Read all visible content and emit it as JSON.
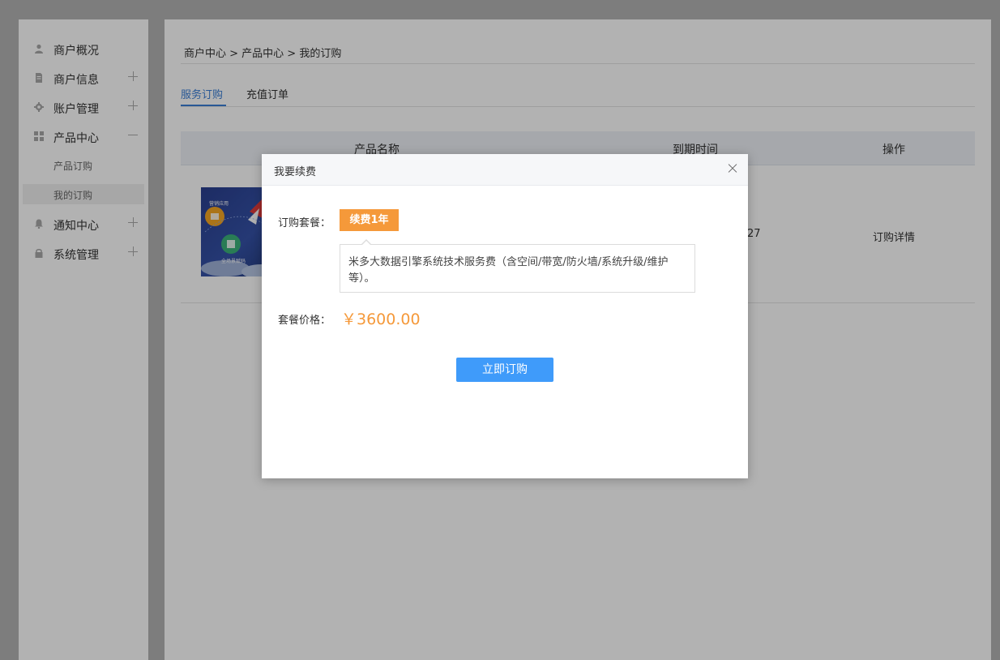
{
  "sidebar": {
    "items": [
      {
        "label": "商户概况",
        "icon": "user-icon"
      },
      {
        "label": "商户信息",
        "icon": "document-icon",
        "expand": "plus"
      },
      {
        "label": "账户管理",
        "icon": "gear-icon",
        "expand": "plus"
      },
      {
        "label": "产品中心",
        "icon": "grid-icon",
        "expand": "minus"
      },
      {
        "label": "通知中心",
        "icon": "bell-icon",
        "expand": "plus"
      },
      {
        "label": "系统管理",
        "icon": "lock-icon",
        "expand": "plus"
      }
    ],
    "sub_items": [
      {
        "label": "产品订购"
      },
      {
        "label": "我的订购",
        "active": true
      }
    ]
  },
  "main": {
    "breadcrumb": "商户中心 > 产品中心 > 我的订购",
    "tabs": [
      {
        "label": "服务订购",
        "active": true
      },
      {
        "label": "充值订单"
      }
    ],
    "table": {
      "headers": [
        "产品名称",
        "到期时间",
        "操作"
      ],
      "row": {
        "thumb_caption_top": "营销应用",
        "thumb_caption_bottom": "全场景赋码",
        "expiry_fragment": "27",
        "action": "订购详情"
      }
    }
  },
  "modal": {
    "title": "我要续费",
    "plan_label": "订购套餐：",
    "plan_tag": "续费1年",
    "plan_description": "米多大数据引擎系统技术服务费（含空间/带宽/防火墙/系统升级/维护等）。",
    "price_label": "套餐价格：",
    "price": "￥3600.00",
    "submit_label": "立即订购"
  },
  "colors": {
    "accent_blue": "#3f9bfa",
    "tab_blue": "#3b7fd6",
    "orange": "#f5993a"
  }
}
